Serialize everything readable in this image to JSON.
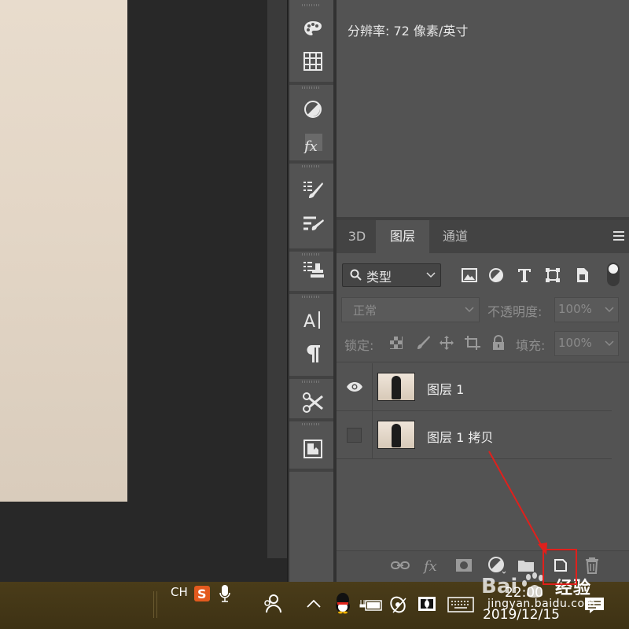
{
  "info": {
    "resolution_text": "分辨率: 72 像素/英寸"
  },
  "tabs": [
    {
      "label": "3D",
      "active": false
    },
    {
      "label": "图层",
      "active": true
    },
    {
      "label": "通道",
      "active": false
    }
  ],
  "filter": {
    "kind_label": "类型"
  },
  "blend": {
    "mode": "正常",
    "opacity_label": "不透明度:",
    "opacity_value": "100%",
    "lock_label": "锁定:",
    "fill_label": "填充:",
    "fill_value": "100%"
  },
  "layers": [
    {
      "name": "图层 1",
      "visible": true
    },
    {
      "name": "图层 1 拷贝",
      "visible": false
    }
  ],
  "taskbar": {
    "input_lang": "CH",
    "time": "22:00",
    "date": "2019/12/15"
  },
  "watermark": {
    "brand": "Baidu经验",
    "url": "jingyan.baidu.com"
  },
  "colors": {
    "accent_red": "#e0201c",
    "panel_bg": "#535353",
    "taskbar_bg": "#4a3c19"
  }
}
